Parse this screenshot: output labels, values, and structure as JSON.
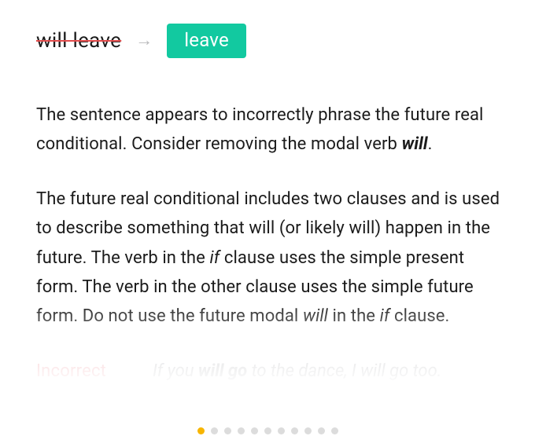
{
  "correction": {
    "original": "will leave",
    "arrow": "→",
    "suggestion": "leave"
  },
  "paragraph1": {
    "t1": "The sentence appears to incorrectly phrase the future real conditional. Consider removing the modal verb ",
    "bi1": "will",
    "t2": "."
  },
  "paragraph2": {
    "t1": "The future real conditional includes two clauses and is used to describe something that will (or likely will) happen in the future. The verb in the ",
    "i1": "if",
    "t2": " clause uses the simple present form. The verb in the other clause uses the simple future form. Do not use the future modal ",
    "i2": "will",
    "t3": " in the ",
    "i3": "if",
    "t4": " clause."
  },
  "example": {
    "label": "Incorrect",
    "t1": "If you ",
    "bi1": "will go",
    "t2": " to the dance, I will go too."
  },
  "pager": {
    "count": 11,
    "active": 0
  },
  "colors": {
    "accent": "#12c9a0",
    "strike": "#e24c4c",
    "pagerActive": "#f7b500",
    "pagerDot": "#dcdcdc"
  }
}
